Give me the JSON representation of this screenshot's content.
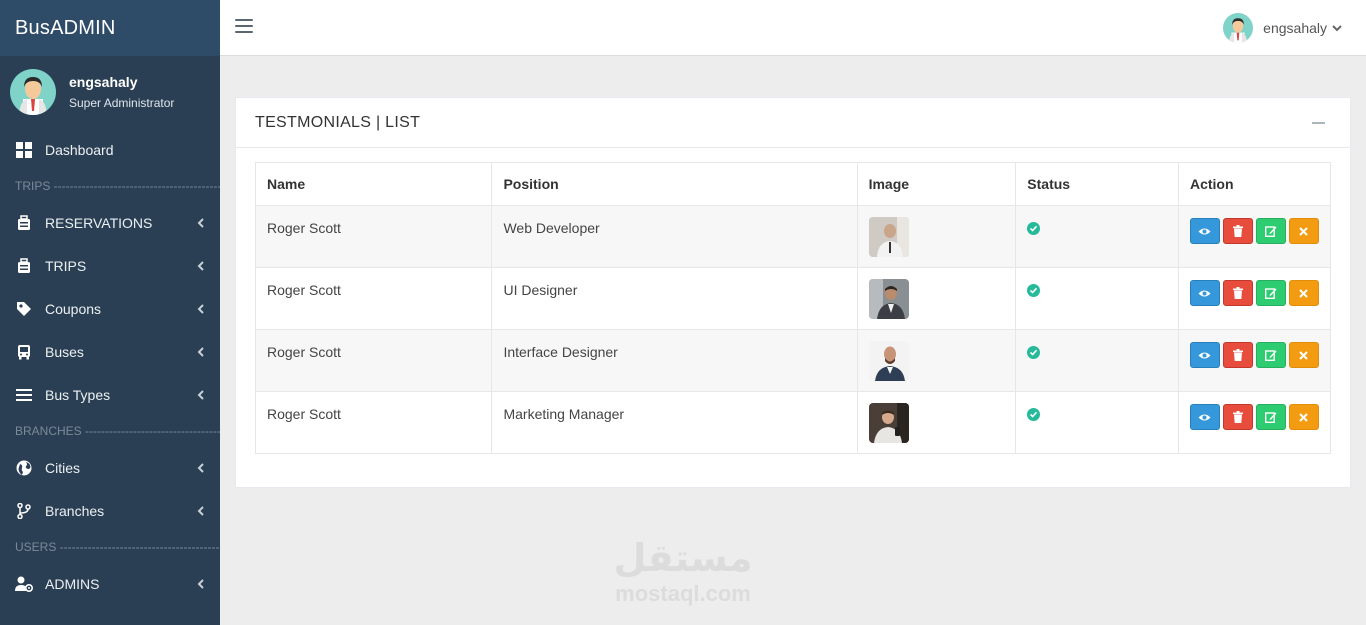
{
  "brand": "BusADMIN",
  "user": {
    "name": "engsahaly",
    "role": "Super Administrator"
  },
  "topbar": {
    "username": "engsahaly"
  },
  "menu": {
    "dashboard": "Dashboard",
    "section_trips": "TRIPS ---------------------------------------------",
    "reservations": "RESERVATIONS",
    "trips": "TRIPS",
    "coupons": "Coupons",
    "buses": "Buses",
    "bus_types": "Bus Types",
    "section_branches": "BRANCHES ---------------------------------------",
    "cities": "Cities",
    "branches": "Branches",
    "section_users": "USERS -------------------------------------------",
    "admins": "ADMINS"
  },
  "panel": {
    "title": "TESTMONIALS | LIST"
  },
  "table": {
    "headers": [
      "Name",
      "Position",
      "Image",
      "Status",
      "Action"
    ],
    "rows": [
      {
        "name": "Roger Scott",
        "position": "Web Developer"
      },
      {
        "name": "Roger Scott",
        "position": "UI Designer"
      },
      {
        "name": "Roger Scott",
        "position": "Interface Designer"
      },
      {
        "name": "Roger Scott",
        "position": "Marketing Manager"
      }
    ]
  },
  "watermark": {
    "arabic": "مستقل",
    "latin": "mostaql.com"
  },
  "colors": {
    "sidebar": "#2a3f54",
    "brand_bar": "#2e4c68",
    "view": "#3498db",
    "delete": "#e74c3c",
    "edit": "#2ecc71",
    "cancel": "#f39c12",
    "status": "#26b99a"
  }
}
